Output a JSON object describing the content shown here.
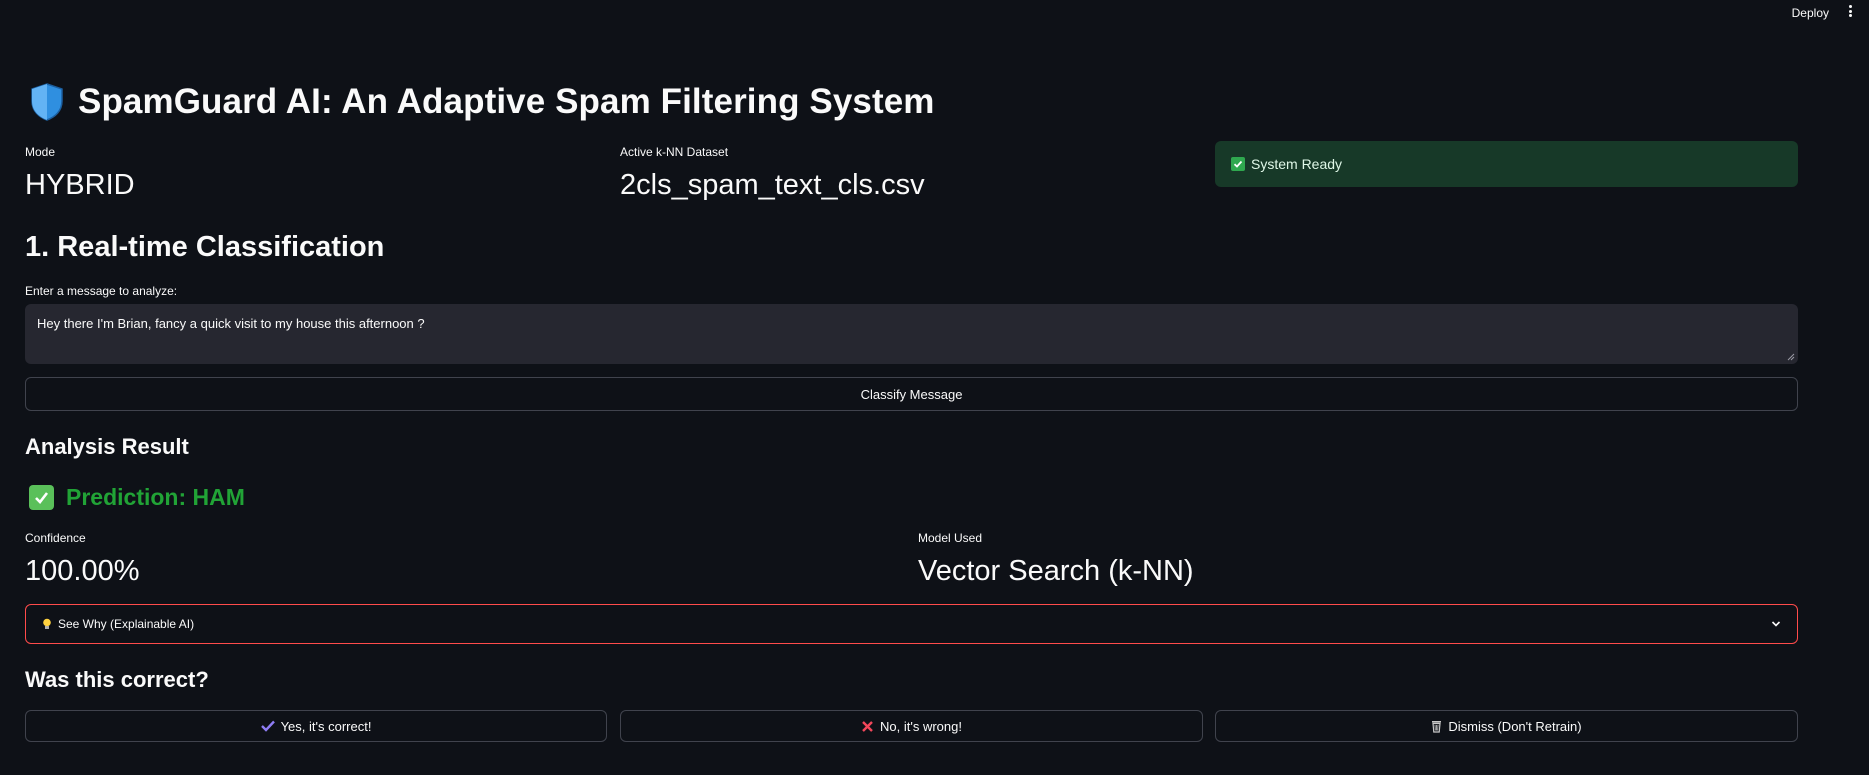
{
  "topbar": {
    "deploy_label": "Deploy"
  },
  "header": {
    "title": "SpamGuard AI: An Adaptive Spam Filtering System",
    "icon": "shield-icon"
  },
  "metrics": {
    "mode": {
      "label": "Mode",
      "value": "HYBRID"
    },
    "dataset": {
      "label": "Active k-NN Dataset",
      "value": "2cls_spam_text_cls.csv"
    }
  },
  "status": {
    "text": "System Ready",
    "color": "#173928"
  },
  "classification": {
    "heading": "1. Real-time Classification",
    "input_label": "Enter a message to analyze:",
    "input_value": "Hey there I'm Brian, fancy a quick visit to my house this afternoon ?",
    "button_label": "Classify Message"
  },
  "result": {
    "heading": "Analysis Result",
    "prediction": "Prediction: HAM",
    "prediction_color": "#21a336",
    "confidence": {
      "label": "Confidence",
      "value": "100.00%"
    },
    "model": {
      "label": "Model Used",
      "value": "Vector Search (k-NN)"
    },
    "explain_label": "See Why (Explainable AI)"
  },
  "feedback": {
    "heading": "Was this correct?",
    "yes_label": "Yes, it's correct!",
    "no_label": "No, it's wrong!",
    "dismiss_label": "Dismiss (Don't Retrain)"
  },
  "colors": {
    "background": "#0e1117",
    "accent_red": "#ff4b4b",
    "success_green": "#21a336"
  }
}
